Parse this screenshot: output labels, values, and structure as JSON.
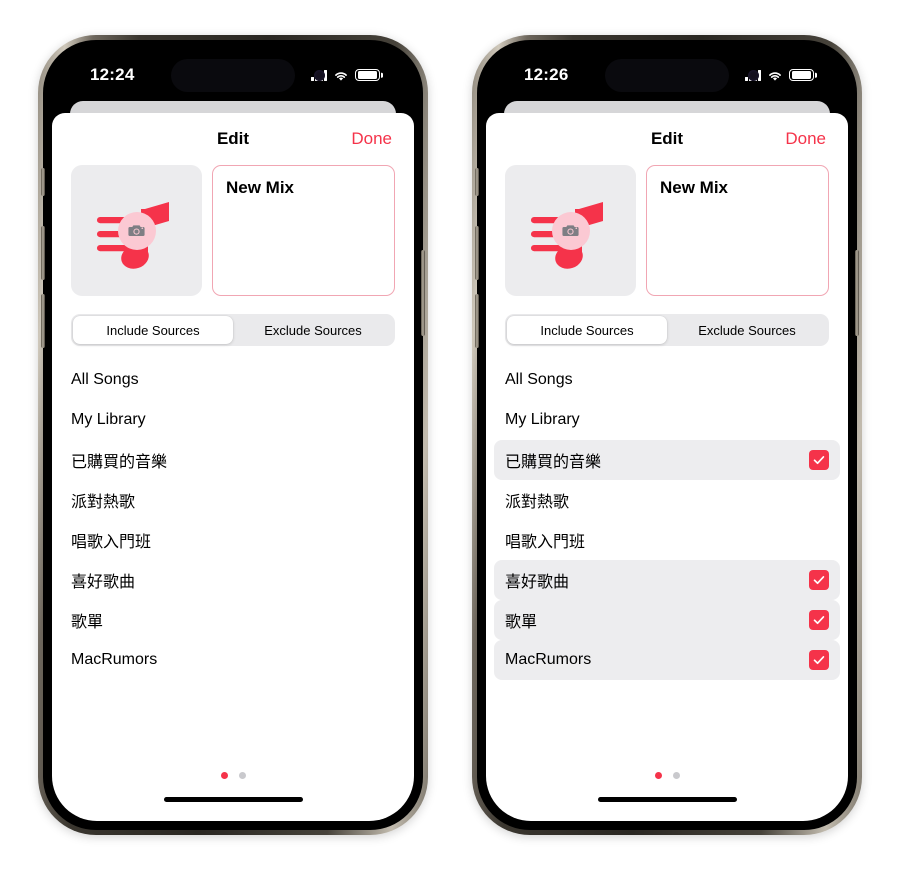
{
  "phones": [
    {
      "id": "phone-left",
      "status_bar": {
        "time": "12:24",
        "signal_icon": "cellular-signal-icon",
        "wifi_icon": "wifi-icon",
        "battery_icon": "battery-icon"
      },
      "navbar": {
        "title": "Edit",
        "done_label": "Done"
      },
      "artwork": {
        "icon": "playlist-music-note-icon",
        "camera_badge_icon": "camera-icon"
      },
      "name_field": {
        "value": "New Mix",
        "placeholder": "Playlist Name"
      },
      "segmented": {
        "options": [
          {
            "label": "Include Sources",
            "selected": true
          },
          {
            "label": "Exclude Sources",
            "selected": false
          }
        ]
      },
      "sources": [
        {
          "label": "All Songs",
          "selected": false
        },
        {
          "label": "My Library",
          "selected": false
        },
        {
          "label": "已購買的音樂",
          "selected": false
        },
        {
          "label": "派對熱歌",
          "selected": false
        },
        {
          "label": "唱歌入門班",
          "selected": false
        },
        {
          "label": "喜好歌曲",
          "selected": false
        },
        {
          "label": "歌單",
          "selected": false
        },
        {
          "label": "MacRumors",
          "selected": false
        }
      ],
      "page_dots": {
        "count": 2,
        "active_index": 0
      }
    },
    {
      "id": "phone-right",
      "status_bar": {
        "time": "12:26",
        "signal_icon": "cellular-signal-icon",
        "wifi_icon": "wifi-icon",
        "battery_icon": "battery-icon"
      },
      "navbar": {
        "title": "Edit",
        "done_label": "Done"
      },
      "artwork": {
        "icon": "playlist-music-note-icon",
        "camera_badge_icon": "camera-icon"
      },
      "name_field": {
        "value": "New Mix",
        "placeholder": "Playlist Name"
      },
      "segmented": {
        "options": [
          {
            "label": "Include Sources",
            "selected": true
          },
          {
            "label": "Exclude Sources",
            "selected": false
          }
        ]
      },
      "sources": [
        {
          "label": "All Songs",
          "selected": false
        },
        {
          "label": "My Library",
          "selected": false
        },
        {
          "label": "已購買的音樂",
          "selected": true
        },
        {
          "label": "派對熱歌",
          "selected": false
        },
        {
          "label": "唱歌入門班",
          "selected": false
        },
        {
          "label": "喜好歌曲",
          "selected": true
        },
        {
          "label": "歌單",
          "selected": true
        },
        {
          "label": "MacRumors",
          "selected": true
        }
      ],
      "page_dots": {
        "count": 2,
        "active_index": 0
      }
    }
  ],
  "colors": {
    "accent_red": "#f5334a",
    "field_border": "#f1a6b3",
    "artwork_bg": "#ececee",
    "row_selected_bg": "#ededef",
    "segment_track": "#eaeaec",
    "dot_inactive": "#c9c9cd"
  }
}
